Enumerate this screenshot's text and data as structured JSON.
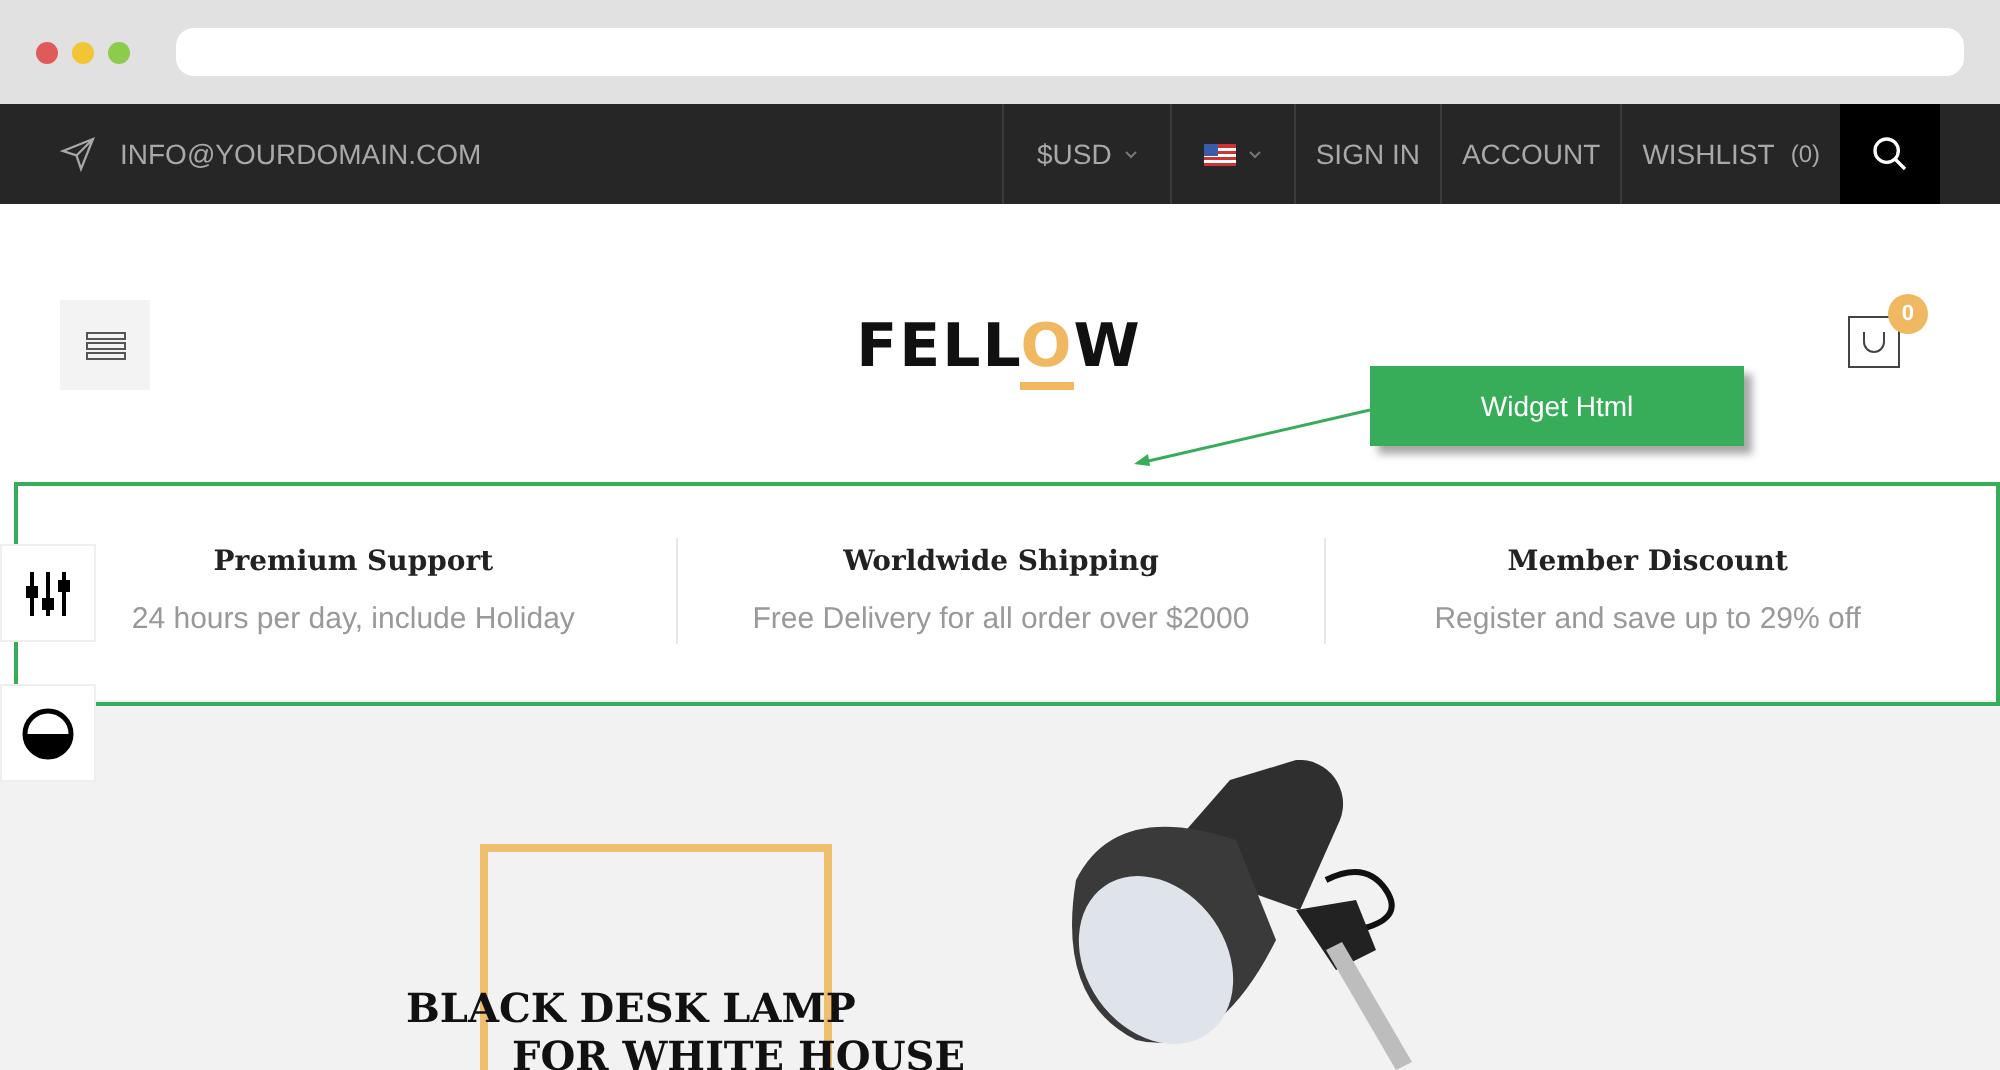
{
  "topbar": {
    "email": "INFO@YOURDOMAIN.COM",
    "currency": "$USD",
    "links": [
      {
        "label": "SIGN IN"
      },
      {
        "label": "ACCOUNT"
      },
      {
        "label": "WISHLIST",
        "count": "(0)"
      }
    ]
  },
  "header": {
    "logo": [
      {
        "text": "FELL",
        "accent": false
      },
      {
        "text": "O",
        "accent": true
      },
      {
        "text": "W",
        "accent": false
      }
    ],
    "cart_count": "0"
  },
  "annotation": {
    "label": "Widget Html"
  },
  "features": [
    {
      "title": "Premium Support",
      "text": "24 hours per day, include Holiday"
    },
    {
      "title": "Worldwide Shipping",
      "text": "Free Delivery for all order over $2000"
    },
    {
      "title": "Member Discount",
      "text": "Register and save up to 29% off"
    }
  ],
  "hero": {
    "title_lines": [
      "BLACK DESK LAMP",
      "FOR WHITE HOUSE"
    ]
  }
}
